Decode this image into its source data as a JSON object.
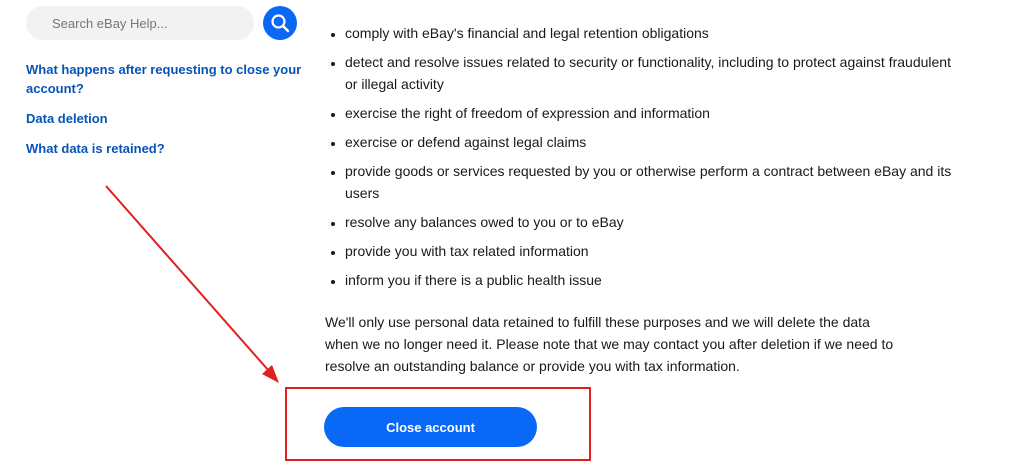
{
  "sidebar": {
    "search": {
      "placeholder": "Search eBay Help...",
      "icon": "search-icon"
    },
    "links": [
      {
        "label": "What happens after requesting to close your account?"
      },
      {
        "label": "Data deletion"
      },
      {
        "label": "What data is retained?"
      }
    ]
  },
  "main": {
    "bullets": [
      "comply with eBay's financial and legal retention obligations",
      "detect and resolve issues related to security or functionality, including to protect against fraudulent or illegal activity",
      "exercise the right of freedom of expression and information",
      "exercise or defend against legal claims",
      "provide goods or services requested by you or otherwise perform a contract between eBay and its users",
      "resolve any balances owed to you or to eBay",
      "provide you with tax related information",
      "inform you if there is a public health issue"
    ],
    "paragraph": "We'll only use personal data retained to fulfill these purposes and we will delete the data when we no longer need it. Please note that we may contact you after deletion if we need to resolve an outstanding balance or provide you with tax information.",
    "close_button_label": "Close account"
  },
  "colors": {
    "accent": "#0968f6",
    "link": "#0654ba",
    "annotation": "#e01f1f"
  }
}
